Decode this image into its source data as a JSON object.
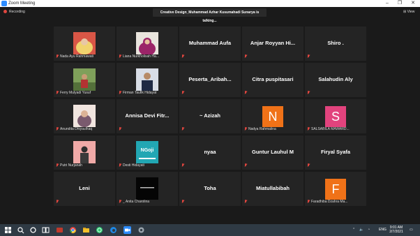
{
  "window": {
    "title": "Zoom Meeting"
  },
  "topbar": {
    "recording_label": "Recording",
    "talking_banner": "Creative Design_Muhammad Azhar Kusumahadi Sunarya is talking...",
    "view_label": "View"
  },
  "tiles": [
    {
      "type": "photo",
      "label": "Nada Ayu Rahmawati",
      "photo": "hijab-red"
    },
    {
      "type": "photo",
      "label": "Liana Nurkholisah Ha...",
      "photo": "hijab-magenta"
    },
    {
      "type": "name",
      "name": "Muhammad Aufa"
    },
    {
      "type": "name",
      "name": "Anjar Royyan Hi..."
    },
    {
      "type": "name",
      "name": "Shiro ."
    },
    {
      "type": "photo",
      "label": "Ferry Mulyadi Yusuf",
      "photo": "outdoor-person"
    },
    {
      "type": "photo",
      "label": "Firman Taufik Hidayat",
      "photo": "man-dark-shirt"
    },
    {
      "type": "name",
      "name": "Peserta_Aribah..."
    },
    {
      "type": "name",
      "name": "Citra puspitasari"
    },
    {
      "type": "name",
      "name": "Salahudin Aly"
    },
    {
      "type": "photo",
      "label": "Anundita Dhiyaulhaq",
      "photo": "woman-light"
    },
    {
      "type": "name",
      "name": "Annisa Devi Fitr..."
    },
    {
      "type": "name",
      "name": "~ Azizah"
    },
    {
      "type": "avatar",
      "label": "Nadya Rahmalina",
      "letter": "N",
      "color": "#f07218"
    },
    {
      "type": "avatar",
      "label": "SALSABILA MAWARD...",
      "letter": "S",
      "color": "#e2437d"
    },
    {
      "type": "photo",
      "label": "Putri Nurjanah",
      "photo": "pink-person"
    },
    {
      "type": "photo",
      "label": "Desti Hidayati",
      "photo": "ngoji-logo",
      "logo_text": "NGoji"
    },
    {
      "type": "name",
      "name": "nyaa"
    },
    {
      "type": "name",
      "name": "Guntur Lauhul M"
    },
    {
      "type": "name",
      "name": "Firyal Syafa"
    },
    {
      "type": "name",
      "name": "Leni"
    },
    {
      "type": "photo",
      "label": "_ Anita Charolina",
      "photo": "black-image"
    },
    {
      "type": "name",
      "name": "Toha"
    },
    {
      "type": "name",
      "name": "Miatullabibah"
    },
    {
      "type": "avatar",
      "label": "Faradhiba Dzahra Ma...",
      "letter": "F",
      "color": "#f07218"
    }
  ],
  "taskbar": {
    "tray_lang": "ENG",
    "time": "9:01 AM",
    "date": "2/7/2021",
    "icons": [
      "windows-start-icon",
      "search-icon",
      "cortana-icon",
      "task-view-icon",
      "app-red-icon",
      "chrome-icon",
      "file-explorer-icon",
      "whatsapp-icon",
      "edge-icon",
      "zoom-icon",
      "settings-icon"
    ]
  }
}
